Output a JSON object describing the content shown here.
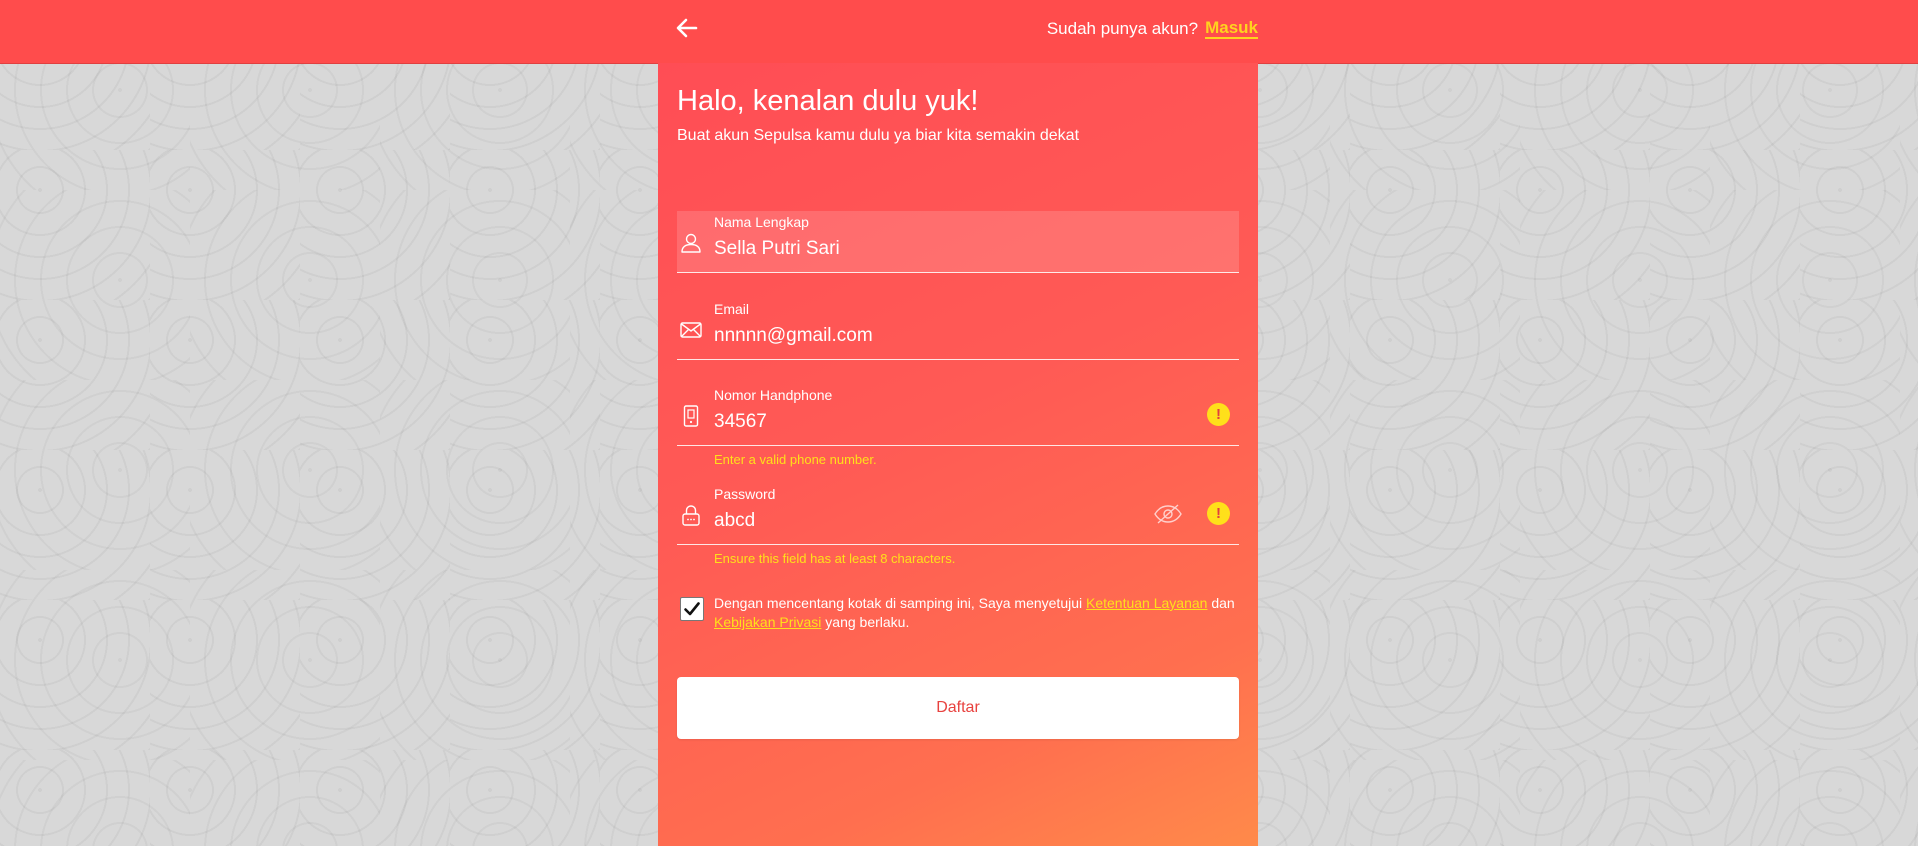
{
  "header": {
    "prompt": "Sudah punya akun?",
    "login_label": "Masuk"
  },
  "intro": {
    "title": "Halo, kenalan dulu yuk!",
    "subtitle": "Buat akun Sepulsa kamu dulu ya biar kita semakin dekat"
  },
  "form": {
    "name": {
      "label": "Nama Lengkap",
      "value": "Sella Putri Sari",
      "icon": "user-icon"
    },
    "email": {
      "label": "Email",
      "value": "nnnnn@gmail.com",
      "icon": "envelope-icon"
    },
    "phone": {
      "label": "Nomor Handphone",
      "value": "34567",
      "icon": "phone-icon",
      "error": "Enter a valid phone number."
    },
    "password": {
      "label": "Password",
      "value": "abcd",
      "icon": "lock-icon",
      "error": "Ensure this field has at least 8 characters."
    }
  },
  "agreement": {
    "checked": true,
    "text_before": "Dengan mencentang kotak di samping ini, Saya menyetujui",
    "terms_link": "Ketentuan Layanan",
    "text_middle": "dan",
    "privacy_link": "Kebijakan Privasi",
    "text_after": "yang berlaku."
  },
  "submit_label": "Daftar",
  "colors": {
    "header_bg": "#ff4c4c",
    "accent_yellow": "#ffe01a",
    "button_text": "#e8423f"
  }
}
